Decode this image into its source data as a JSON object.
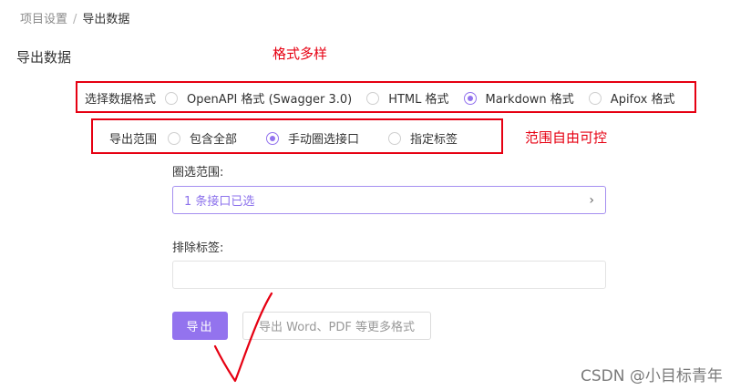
{
  "breadcrumb": {
    "parent": "项目设置",
    "separator": "/",
    "current": "导出数据"
  },
  "page_title": "导出数据",
  "annotations": {
    "formats": "格式多样",
    "scope": "范围自由可控"
  },
  "format_row": {
    "label": "选择数据格式",
    "options": [
      {
        "label": "OpenAPI 格式 (Swagger 3.0)",
        "selected": false
      },
      {
        "label": "HTML 格式",
        "selected": false
      },
      {
        "label": "Markdown 格式",
        "selected": true
      },
      {
        "label": "Apifox 格式",
        "selected": false
      }
    ]
  },
  "scope_row": {
    "label": "导出范围",
    "options": [
      {
        "label": "包含全部",
        "selected": false
      },
      {
        "label": "手动圈选接口",
        "selected": true
      },
      {
        "label": "指定标签",
        "selected": false
      }
    ]
  },
  "selection": {
    "label": "圈选范围:",
    "value": "1 条接口已选",
    "chevron": "›"
  },
  "exclude_tags": {
    "label": "排除标签:",
    "value": ""
  },
  "buttons": {
    "export": "导出",
    "more_formats": "导出 Word、PDF 等更多格式"
  },
  "watermark": "CSDN @小目标青年",
  "colors": {
    "accent": "#9373ee",
    "annotation_red": "#e60012"
  }
}
